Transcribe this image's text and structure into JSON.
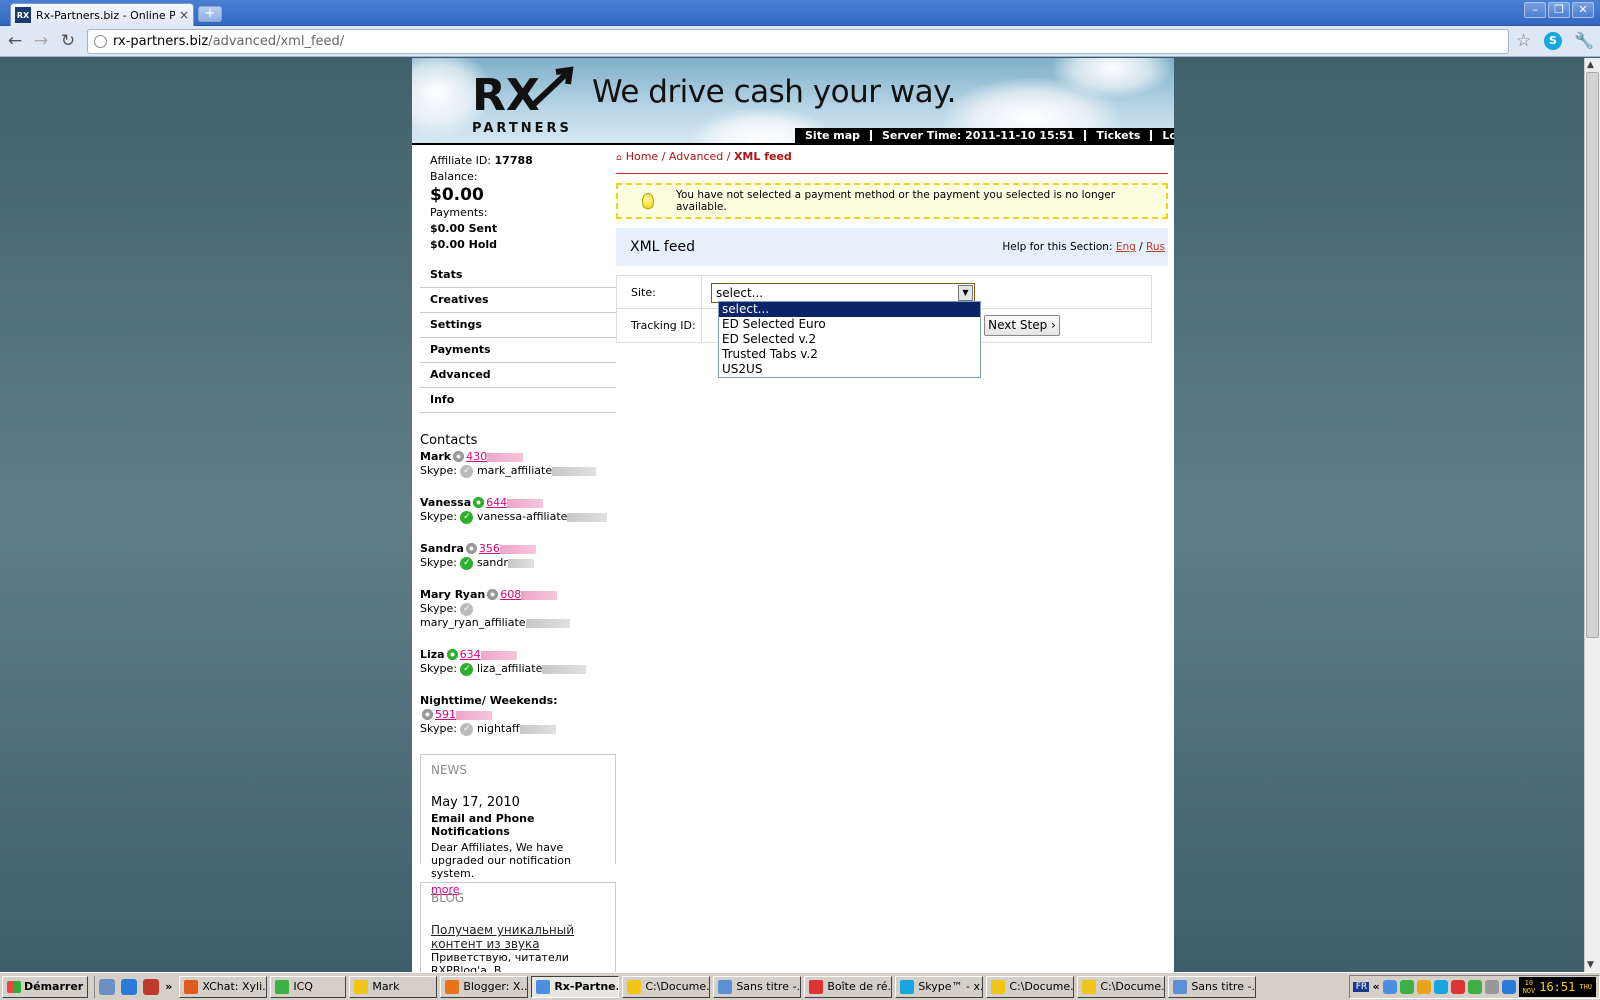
{
  "browser": {
    "tab_title": "Rx-Partners.biz - Online Pharm",
    "tab_favicon": "RX",
    "tab_close": "×",
    "new_tab": "+",
    "url_domain": "rx-partners.biz",
    "url_path": "/advanced/xml_feed/",
    "window_buttons": [
      "–",
      "❐",
      "✕"
    ]
  },
  "header": {
    "logo_word": "RX",
    "logo_sub": "PARTNERS",
    "slogan": "We drive cash your way.",
    "menu": [
      "Site map",
      "Server Time: 2011-11-10 15:51",
      "Tickets",
      "Logout"
    ]
  },
  "account": {
    "affiliate_label": "Affiliate ID:",
    "affiliate_id": "17788",
    "balance_label": "Balance:",
    "balance": "$0.00",
    "payments_label": "Payments:",
    "sent": "$0.00 Sent",
    "hold": "$0.00 Hold"
  },
  "nav": [
    "Stats",
    "Creatives",
    "Settings",
    "Payments",
    "Advanced",
    "Info"
  ],
  "contacts": {
    "title": "Contacts",
    "skype_label": "Skype:",
    "people": [
      {
        "name": "Mark",
        "phone": "430",
        "skype": "mark_affiliate",
        "online": false
      },
      {
        "name": "Vanessa",
        "phone": "644",
        "skype": "vanessa-affiliate",
        "online": true
      },
      {
        "name": "Sandra",
        "phone": "356",
        "skype": "sandr",
        "online": true
      },
      {
        "name": "Mary Ryan",
        "phone": "608",
        "skype": "mary_ryan_affiliate",
        "online": false
      },
      {
        "name": "Liza",
        "phone": "634",
        "skype": "liza_affiliate",
        "online": true
      },
      {
        "name": "Nighttime/ Weekends:",
        "phone": "591",
        "skype": "nightaff",
        "online": false
      }
    ]
  },
  "news": {
    "title": "NEWS",
    "date": "May 17, 2010",
    "headline": "Email and Phone Notifications",
    "body": "Dear Affiliates, We have upgraded our notification system.",
    "more": "more"
  },
  "blog": {
    "title": "BLOG",
    "link": "Получаем уникальный контент из звука",
    "snippet": "Приветствую, читатели RXPBlog'a. В"
  },
  "breadcrumb": {
    "home": "Home",
    "sep": " / ",
    "advanced": "Advanced",
    "current": "XML feed"
  },
  "warning": "You have not selected a payment method or the payment you selected is no longer available.",
  "section": {
    "title": "XML feed",
    "help_label": "Help for this Section:",
    "eng": "Eng",
    "rus": "Rus",
    "slash": " / "
  },
  "form": {
    "site_label": "Site:",
    "site_value": "select...",
    "tracking_label": "Tracking ID:",
    "next_button": "Next Step ›",
    "options": [
      "select...",
      "ED Selected Euro",
      "ED Selected v.2",
      "Trusted Tabs v.2",
      "US2US"
    ]
  },
  "taskbar": {
    "start": "Démarrer",
    "more": "»",
    "items": [
      {
        "label": "XChat: Xyli...",
        "color": "#e05a1c",
        "active": false
      },
      {
        "label": "ICQ",
        "color": "#3cb043",
        "active": false
      },
      {
        "label": "Mark",
        "color": "#f0c419",
        "active": false
      },
      {
        "label": "Blogger: X...",
        "color": "#e8731c",
        "active": false
      },
      {
        "label": "Rx-Partne...",
        "color": "#4a8fe0",
        "active": true
      },
      {
        "label": "C:\\Docume...",
        "color": "#f0c419",
        "active": false
      },
      {
        "label": "Sans titre -...",
        "color": "#5c8fd6",
        "active": false
      },
      {
        "label": "Boîte de ré...",
        "color": "#d33",
        "active": false
      },
      {
        "label": "Skype™ - x...",
        "color": "#18a6e0",
        "active": false
      },
      {
        "label": "C:\\Docume...",
        "color": "#f0c419",
        "active": false
      },
      {
        "label": "C:\\Docume...",
        "color": "#f0c419",
        "active": false
      },
      {
        "label": "Sans titre -...",
        "color": "#5c8fd6",
        "active": false
      }
    ],
    "lang": "FR",
    "tray_more": "«",
    "clock_day": "10",
    "clock_month": "NOV",
    "clock_time": "16:51",
    "clock_weekday": "THU"
  }
}
